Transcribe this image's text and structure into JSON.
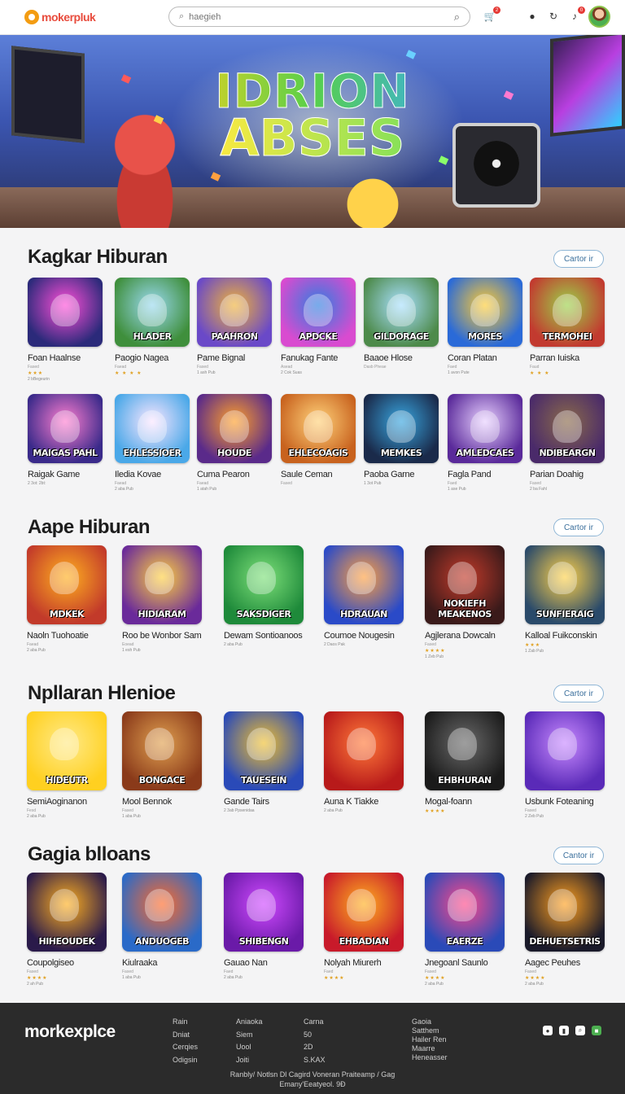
{
  "header": {
    "logo_text": "mokerpluk",
    "search_placeholder": "haegieh",
    "cart_badge": "2",
    "notif_badge": "0"
  },
  "hero": {
    "title_line1": "IDRION",
    "title_line2": "ABSES"
  },
  "sections": [
    {
      "title": "Kagkar Hiburan",
      "button": "Cartor ir",
      "items": [
        {
          "name": "Foan Haalnse",
          "dev": "Fased",
          "stars": "★★★",
          "downloads": "2 bBegeurin",
          "art": "",
          "colors": [
            "#2b2a7a",
            "#ff4fd8"
          ]
        },
        {
          "name": "Paogio Nagea",
          "dev": "Faead",
          "stars": "★ ★ ★ ★",
          "downloads": "",
          "art": "HLADER",
          "colors": [
            "#3f8f3c",
            "#9ad9f0"
          ]
        },
        {
          "name": "Pame Bignal",
          "dev": "Fased",
          "stars": "",
          "downloads": "1 ash Pub",
          "art": "PAAHRON",
          "colors": [
            "#6a49c8",
            "#f0b33a"
          ]
        },
        {
          "name": "Fanukag Fante",
          "dev": "Asead",
          "stars": "",
          "downloads": "2 Cok Suas",
          "art": "APDCKE",
          "colors": [
            "#d94bd0",
            "#2f7fe0"
          ]
        },
        {
          "name": "Baaoe Hlose",
          "dev": "Dasb Pheae",
          "stars": "",
          "downloads": "",
          "art": "GILDORAGE",
          "colors": [
            "#4d8a4a",
            "#a9e0ff"
          ]
        },
        {
          "name": "Coran Platan",
          "dev": "Faed",
          "stars": "",
          "downloads": "1 avon Pute",
          "art": "MORES",
          "colors": [
            "#2a6ad8",
            "#ffcc33"
          ]
        },
        {
          "name": "Parran Iuiska",
          "dev": "Faud",
          "stars": "★ ★ ★",
          "downloads": "",
          "art": "TERMOHEI",
          "colors": [
            "#c23a2f",
            "#9bd24a"
          ]
        }
      ]
    },
    {
      "title": "",
      "button": "",
      "items": [
        {
          "name": "Raigak Game",
          "dev": "",
          "stars": "",
          "downloads": "2 3ot: 2bt:",
          "art": "MAIGAS PAHL",
          "colors": [
            "#3a2a8a",
            "#ff7fd0"
          ]
        },
        {
          "name": "Iledia Kovae",
          "dev": "Faead",
          "stars": "",
          "downloads": "2 aba Pub",
          "art": "EHLESSIOER",
          "colors": [
            "#4aa8e8",
            "#fbe6ff"
          ]
        },
        {
          "name": "Cuma Pearon",
          "dev": "Faead",
          "stars": "",
          "downloads": "1 atah Pub",
          "art": "HOUDE",
          "colors": [
            "#5a2a8a",
            "#ffa02a"
          ]
        },
        {
          "name": "Saule Ceman",
          "dev": "Fased",
          "stars": "",
          "downloads": "",
          "art": "EHLECOAGIS",
          "colors": [
            "#c8621e",
            "#ffd27a"
          ]
        },
        {
          "name": "Paoba Garne",
          "dev": "",
          "stars": "",
          "downloads": "1 3ot Pub",
          "art": "MEMKES",
          "colors": [
            "#1a2a4a",
            "#39a6e0"
          ]
        },
        {
          "name": "Fagla Pand",
          "dev": "Faed",
          "stars": "",
          "downloads": "1 ase Pub",
          "art": "AMLEDCAES",
          "colors": [
            "#5a2a9a",
            "#e8d0ff"
          ]
        },
        {
          "name": "Parian Doahig",
          "dev": "Fased",
          "stars": "",
          "downloads": "2 ba Fahl",
          "art": "NDIBEARGN",
          "colors": [
            "#4a2a6a",
            "#8a6a4a"
          ]
        }
      ]
    },
    {
      "title": "Aape Hiburan",
      "button": "Cartor ir",
      "items": [
        {
          "name": "Naoln Tuohoatie",
          "dev": "Faead",
          "stars": "",
          "downloads": "2 aba Pub",
          "art": "MDKEK",
          "colors": [
            "#c23a2a",
            "#ffb020"
          ]
        },
        {
          "name": "Roo be Wonbor Sam",
          "dev": "Eoead",
          "stars": "",
          "downloads": "1 esh Pub",
          "art": "HIDIARAM",
          "colors": [
            "#6a2a9a",
            "#ffd040"
          ]
        },
        {
          "name": "Dewam Sontioanoos",
          "dev": "",
          "stars": "",
          "downloads": "2 aba Pub",
          "art": "SAKSDIGER",
          "colors": [
            "#1e8a3a",
            "#7ee07a"
          ]
        },
        {
          "name": "Coumoe Nougesin",
          "dev": "",
          "stars": "",
          "downloads": "2 Daos Pak",
          "art": "HDRAUAN",
          "colors": [
            "#2a4ac8",
            "#ffa040"
          ]
        },
        {
          "name": "Agjlerana Dowcaln",
          "dev": "Fased",
          "stars": "★★★★",
          "downloads": "1 Zeb Pub",
          "art": "NOKIEFH MEAKENOS",
          "colors": [
            "#3a1a1a",
            "#c23a2a"
          ]
        },
        {
          "name": "Kalloal Fuikconskin",
          "dev": "",
          "stars": "★★★",
          "downloads": "1 Zab Pub",
          "art": "SUNFIERAIG",
          "colors": [
            "#2a4a6a",
            "#ffd24a"
          ]
        }
      ]
    },
    {
      "title": "Npllaran Hlenioe",
      "button": "Cartor ir",
      "items": [
        {
          "name": "SemiAoginanon",
          "dev": "Fesd",
          "stars": "",
          "downloads": "2 aba Pub",
          "art": "HIDEUTR",
          "colors": [
            "#ffd020",
            "#ffea88"
          ]
        },
        {
          "name": "Mool Bennok",
          "dev": "Fased",
          "stars": "",
          "downloads": "1 aba Pub",
          "art": "BONGACE",
          "colors": [
            "#8a3a1a",
            "#e0a050"
          ]
        },
        {
          "name": "Gande Tairs",
          "dev": "",
          "stars": "",
          "downloads": "2 3ab Ppsenidaa",
          "art": "TAUESEIN",
          "colors": [
            "#2a4ab8",
            "#f0c030"
          ]
        },
        {
          "name": "Auna K Tiakke",
          "dev": "",
          "stars": "",
          "downloads": "2 aba Pub",
          "art": "",
          "colors": [
            "#b81a1a",
            "#ff7a3a"
          ]
        },
        {
          "name": "Mogal-foann",
          "dev": "",
          "stars": "★★★★",
          "downloads": "",
          "art": "EHBHURAN",
          "colors": [
            "#1a1a1a",
            "#6a6a6a"
          ]
        },
        {
          "name": "Usbunk Foteaning",
          "dev": "Fased",
          "stars": "",
          "downloads": "2 Zeb Pub",
          "art": "",
          "colors": [
            "#5a2ab8",
            "#c88aff"
          ]
        }
      ]
    },
    {
      "title": "Gagia blloans",
      "button": "Cantor ir",
      "items": [
        {
          "name": "Coupolgiseo",
          "dev": "Fased",
          "stars": "★★★★",
          "downloads": "2 ah Pub",
          "art": "HIHEOUDEK",
          "colors": [
            "#2a1a4a",
            "#ffb020"
          ]
        },
        {
          "name": "Kiulraaka",
          "dev": "Fased",
          "stars": "",
          "downloads": "1 aba Pub",
          "art": "ANDUOGEB",
          "colors": [
            "#2a6ac8",
            "#ff6a2a"
          ]
        },
        {
          "name": "Gauao Nan",
          "dev": "Faed",
          "stars": "",
          "downloads": "2 aba Pub",
          "art": "SHIBENGN",
          "colors": [
            "#6a1aa8",
            "#d04aff"
          ]
        },
        {
          "name": "Nolyah Miurerh",
          "dev": "Faed",
          "stars": "★★★★",
          "downloads": "",
          "art": "EHBADIAN",
          "colors": [
            "#c81a2a",
            "#ffb020"
          ]
        },
        {
          "name": "Jnegoanl Saunlo",
          "dev": "Fased",
          "stars": "★★★★",
          "downloads": "2 aba Pub",
          "art": "EAERZE",
          "colors": [
            "#2a4ab8",
            "#ff4a8a"
          ]
        },
        {
          "name": "Aagec Peuhes",
          "dev": "Fased",
          "stars": "★★★★",
          "downloads": "2 aba Pub",
          "art": "DEHUETSETRIS",
          "colors": [
            "#1a1a2a",
            "#ffa020"
          ]
        }
      ]
    }
  ],
  "footer": {
    "logo": "morkexplce",
    "col1": [
      "Rain",
      "Dniat",
      "Cerqies",
      "Odigsin"
    ],
    "col2": [
      "Aniaoka",
      "Siem",
      "Uool",
      "Joiti"
    ],
    "col3": [
      "Carna",
      "50",
      "2D",
      "S.KAX"
    ],
    "col4": [
      "Gaoia",
      "Satthem",
      "Hailer Ren",
      "Maarre",
      "Heneasser"
    ],
    "copyright1": "Ranbly/ Notlsn Dl Cagird Voneran Praiteamp / Gag",
    "copyright2": "Emany'Eeatyeol. 9Ð"
  }
}
